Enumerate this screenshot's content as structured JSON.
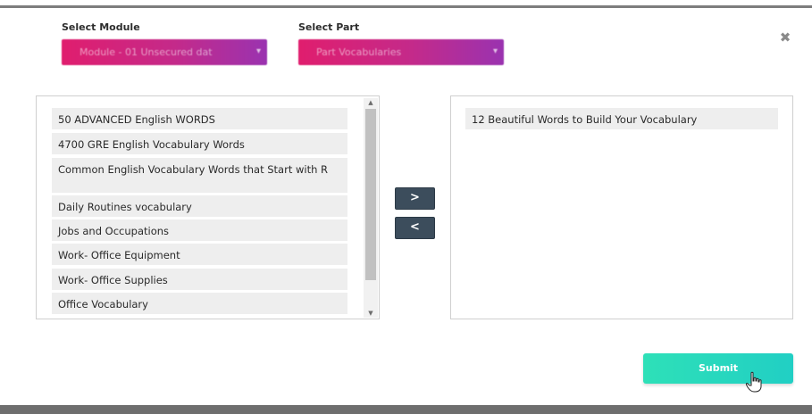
{
  "module": {
    "label": "Select Module",
    "selected_value": "Module - 01 Unsecured dat"
  },
  "part": {
    "label": "Select Part",
    "selected_value": "Part Vocabularies"
  },
  "close_icon": "close-icon",
  "available_list": {
    "items": [
      "50 ADVANCED English WORDS",
      "4700 GRE English Vocabulary Words",
      "Common English Vocabulary Words that Start with R",
      "Daily Routines vocabulary",
      "Jobs and Occupations",
      "Work- Office Equipment",
      "Work- Office Supplies",
      "Office Vocabulary"
    ]
  },
  "selected_list": {
    "items": [
      "12 Beautiful Words to Build Your Vocabulary"
    ]
  },
  "buttons": {
    "move_right": ">",
    "move_left": "<",
    "submit": "Submit"
  },
  "colors": {
    "select_gradient_start": "#e01e6e",
    "select_gradient_end": "#9a33b0",
    "arrow_button": "#3c4d5c",
    "submit_gradient_start": "#2ee0b8",
    "submit_gradient_end": "#21cfc4"
  }
}
